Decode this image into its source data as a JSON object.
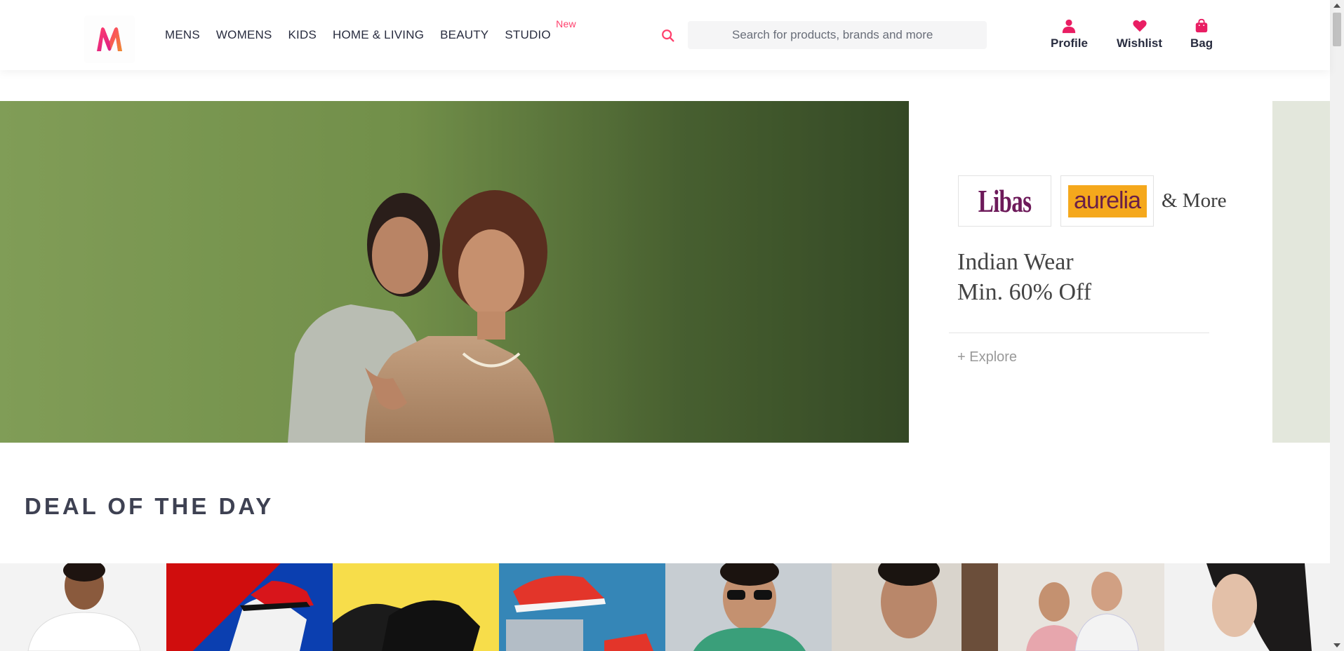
{
  "header": {
    "logo_letter": "M",
    "nav": [
      {
        "label": "MENS"
      },
      {
        "label": "WOMENS"
      },
      {
        "label": "KIDS"
      },
      {
        "label": "HOME & LIVING"
      },
      {
        "label": "BEAUTY"
      },
      {
        "label": "STUDIO",
        "badge": "New"
      }
    ],
    "search": {
      "placeholder": "Search for products, brands and more",
      "icon": "search-icon"
    },
    "actions": [
      {
        "label": "Profile",
        "icon": "profile-icon"
      },
      {
        "label": "Wishlist",
        "icon": "heart-icon"
      },
      {
        "label": "Bag",
        "icon": "bag-icon"
      }
    ]
  },
  "hero": {
    "brands": [
      "Libas",
      "aurelia"
    ],
    "and_more": "& More",
    "title_line1": "Indian Wear",
    "title_line2": "Min. 60% Off",
    "cta": "+ Explore"
  },
  "deal": {
    "title": "DEAL OF THE DAY",
    "cards": [
      {
        "name": "deal-card-mens-tshirt"
      },
      {
        "name": "deal-card-sneakers-red"
      },
      {
        "name": "deal-card-black-shoes"
      },
      {
        "name": "deal-card-sports-shoes"
      },
      {
        "name": "deal-card-sunglasses"
      },
      {
        "name": "deal-card-mens-portrait"
      },
      {
        "name": "deal-card-mens-shirts"
      },
      {
        "name": "deal-card-womens-portrait"
      }
    ]
  },
  "colors": {
    "accent": "#ff3f6c",
    "text": "#282c3f",
    "icon": "#e91e63"
  }
}
